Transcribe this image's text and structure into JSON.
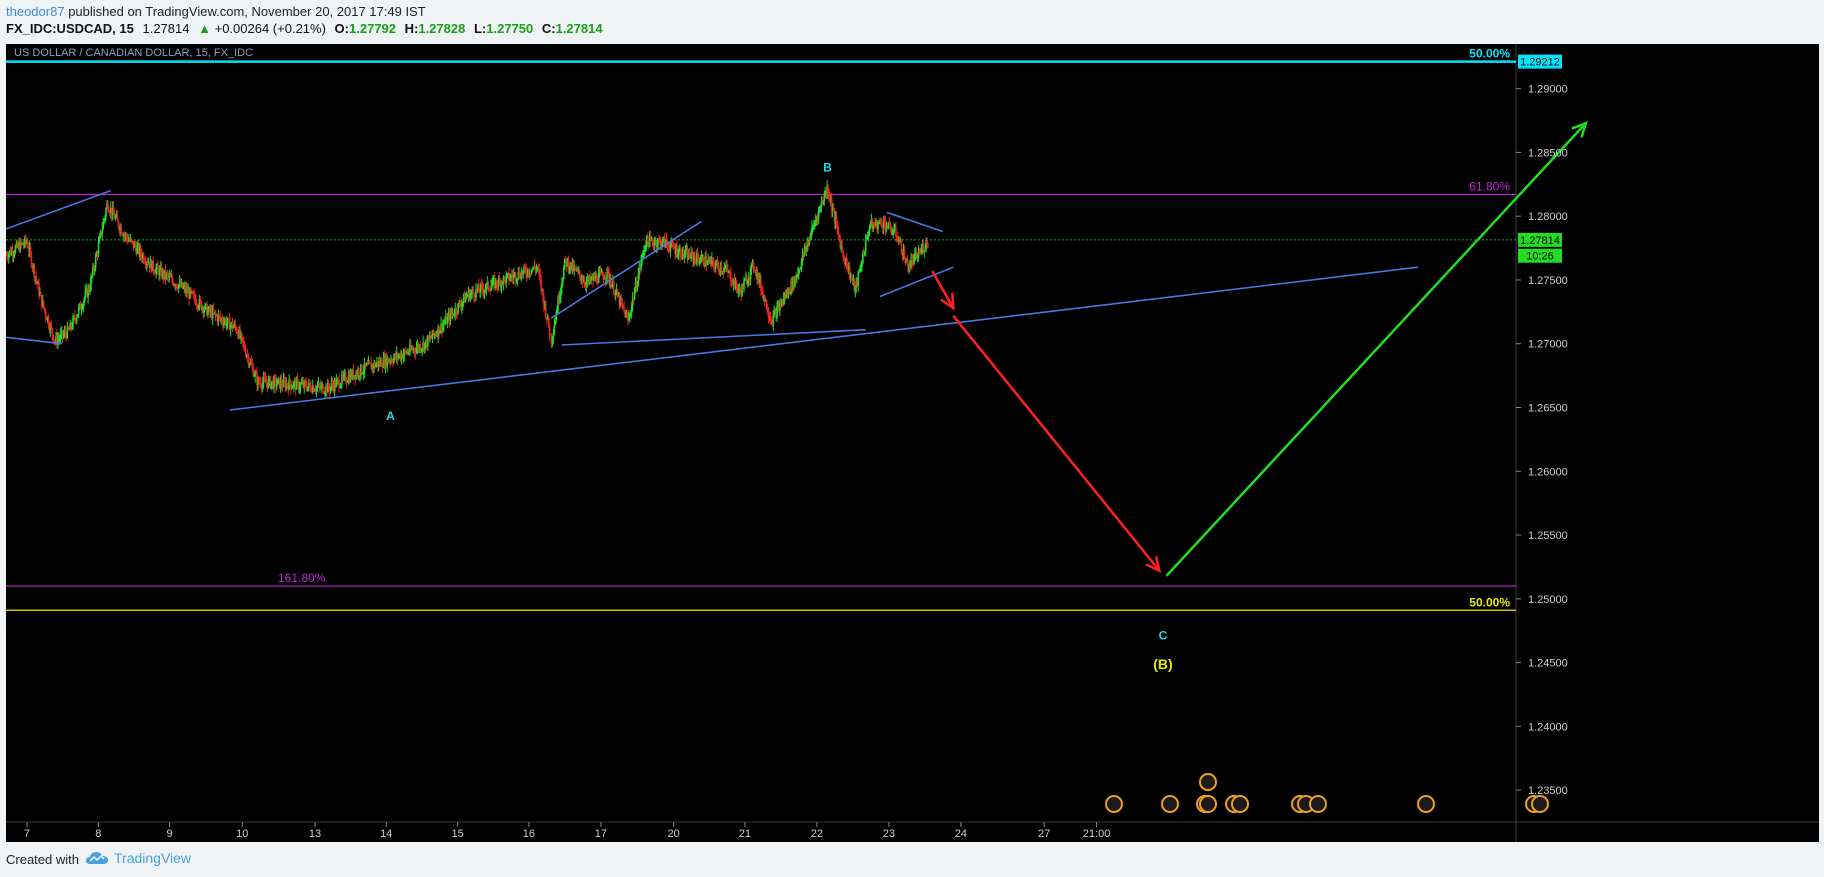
{
  "header": {
    "author": "theodor87",
    "published": "published on TradingView.com, November 20, 2017 17:49 IST",
    "symbol": "FX_IDC:USDCAD, 15",
    "last": "1.27814",
    "change": "+0.00264 (+0.21%)",
    "o_label": "O:",
    "o": "1.27792",
    "h_label": "H:",
    "h": "1.27828",
    "l_label": "L:",
    "l": "1.27750",
    "c_label": "C:",
    "c": "1.27814"
  },
  "footer": {
    "created_with": "Created with",
    "brand": "TradingView"
  },
  "chart_data": {
    "type": "candlestick",
    "title": "US DOLLAR / CANADIAN DOLLAR, 15, FX_IDC",
    "x_labels": [
      "7",
      "8",
      "9",
      "10",
      "13",
      "14",
      "15",
      "16",
      "17",
      "20",
      "21",
      "22",
      "23",
      "24",
      "27",
      "21:00"
    ],
    "y_ticks": [
      1.235,
      1.24,
      1.245,
      1.25,
      1.255,
      1.26,
      1.265,
      1.27,
      1.275,
      1.28,
      1.285,
      1.29
    ],
    "y_tick_labels": [
      "1.23500",
      "1.24000",
      "1.24500",
      "1.25000",
      "1.25500",
      "1.26000",
      "1.26500",
      "1.27000",
      "1.27500",
      "1.28000",
      "1.28500",
      "1.29000"
    ],
    "ylim": [
      1.2325,
      1.2935
    ],
    "x_domain": [
      6.4,
      28
    ],
    "price_path": [
      [
        6.4,
        1.277
      ],
      [
        6.7,
        1.278
      ],
      [
        6.9,
        1.2735
      ],
      [
        7.1,
        1.2702
      ],
      [
        7.3,
        1.271
      ],
      [
        7.6,
        1.2745
      ],
      [
        7.85,
        1.281
      ],
      [
        8.1,
        1.2785
      ],
      [
        8.5,
        1.276
      ],
      [
        8.9,
        1.2745
      ],
      [
        9.3,
        1.2725
      ],
      [
        9.7,
        1.2712
      ],
      [
        10.0,
        1.267
      ],
      [
        10.5,
        1.2668
      ],
      [
        11.0,
        1.2665
      ],
      [
        11.5,
        1.268
      ],
      [
        12.0,
        1.269
      ],
      [
        12.4,
        1.27
      ],
      [
        12.7,
        1.2718
      ],
      [
        13.0,
        1.2738
      ],
      [
        13.3,
        1.2745
      ],
      [
        13.6,
        1.2752
      ],
      [
        14.0,
        1.276
      ],
      [
        14.2,
        1.2703
      ],
      [
        14.4,
        1.2765
      ],
      [
        14.7,
        1.2748
      ],
      [
        15.0,
        1.2755
      ],
      [
        15.3,
        1.2718
      ],
      [
        15.55,
        1.278
      ],
      [
        15.8,
        1.278
      ],
      [
        16.1,
        1.277
      ],
      [
        16.4,
        1.2765
      ],
      [
        16.7,
        1.2758
      ],
      [
        16.9,
        1.274
      ],
      [
        17.1,
        1.2762
      ],
      [
        17.35,
        1.2718
      ],
      [
        17.7,
        1.2752
      ],
      [
        18.0,
        1.28
      ],
      [
        18.15,
        1.2823
      ],
      [
        18.35,
        1.2775
      ],
      [
        18.55,
        1.2742
      ],
      [
        18.75,
        1.2792
      ],
      [
        18.95,
        1.2795
      ],
      [
        19.15,
        1.2785
      ],
      [
        19.3,
        1.276
      ],
      [
        19.45,
        1.277
      ],
      [
        19.6,
        1.2782
      ]
    ],
    "levels": [
      {
        "label": "50.00%",
        "price": 1.29212,
        "color": "#00e5ff"
      },
      {
        "label": "61.80%",
        "price": 1.2817,
        "color": "#c026d3"
      },
      {
        "label": "161.80%",
        "price": 1.251,
        "color": "#c026d3"
      },
      {
        "label": "50.00%",
        "price": 1.2491,
        "color": "#e8e800"
      }
    ],
    "axis_labels": [
      {
        "text": "1.29212",
        "price": 1.29212,
        "bg": "#00e5ff",
        "fg": "#000"
      },
      {
        "text": "1.27814",
        "price": 1.27814,
        "bg": "#22dd22",
        "fg": "#000"
      },
      {
        "text": "10:26",
        "price": 1.2769,
        "bg": "#22dd22",
        "fg": "#000"
      }
    ],
    "current_price": 1.27814,
    "trendlines": [
      {
        "from": [
          6.4,
          1.279
        ],
        "to": [
          7.9,
          1.282
        ]
      },
      {
        "from": [
          6.4,
          1.2705
        ],
        "to": [
          7.2,
          1.27
        ]
      },
      {
        "from": [
          9.6,
          1.2648
        ],
        "to": [
          26.6,
          1.276
        ]
      },
      {
        "from": [
          14.2,
          1.272
        ],
        "to": [
          16.35,
          1.2796
        ]
      },
      {
        "from": [
          14.35,
          1.2699
        ],
        "to": [
          18.7,
          1.2711
        ]
      },
      {
        "from": [
          19.0,
          1.2803
        ],
        "to": [
          19.8,
          1.2788
        ]
      },
      {
        "from": [
          18.9,
          1.2737
        ],
        "to": [
          19.95,
          1.276
        ]
      }
    ],
    "arrows": [
      {
        "color": "#ff2020",
        "from": [
          19.65,
          1.2757
        ],
        "to": [
          19.95,
          1.2728
        ]
      },
      {
        "color": "#ff2020",
        "from": [
          19.95,
          1.2722
        ],
        "to": [
          22.9,
          1.2522
        ]
      },
      {
        "color": "#22dd22",
        "from": [
          23.0,
          1.2518
        ],
        "to": [
          29.0,
          1.2873
        ]
      }
    ],
    "wave_labels": [
      {
        "text": "A",
        "x": 11.9,
        "y": 1.264,
        "color": "#28d8e8",
        "size": 12
      },
      {
        "text": "B",
        "x": 18.15,
        "y": 1.2835,
        "color": "#28d8e8",
        "size": 12
      },
      {
        "text": "C",
        "x": 22.95,
        "y": 1.2468,
        "color": "#28d8e8",
        "size": 12
      },
      {
        "text": "(B)",
        "x": 22.95,
        "y": 1.2445,
        "color": "#e8e800",
        "size": 14
      }
    ]
  }
}
